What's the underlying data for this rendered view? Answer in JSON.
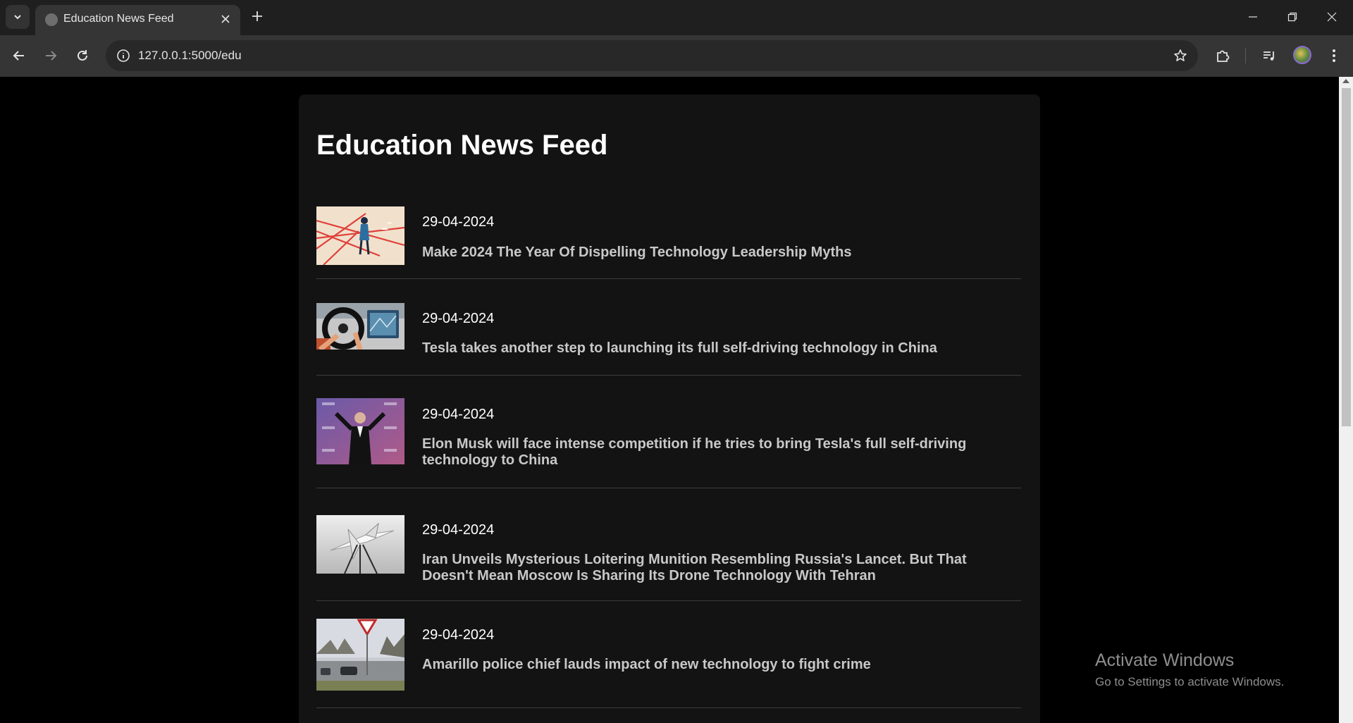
{
  "browser": {
    "tab_title": "Education News Feed",
    "url": "127.0.0.1:5000/edu"
  },
  "page": {
    "title": "Education News Feed"
  },
  "news": [
    {
      "date": "29-04-2024",
      "title": "Make 2024 The Year Of Dispelling Technology Leadership Myths"
    },
    {
      "date": "29-04-2024",
      "title": "Tesla takes another step to launching its full self-driving technology in China"
    },
    {
      "date": "29-04-2024",
      "title": "Elon Musk will face intense competition if he tries to bring Tesla's full self-driving technology to China"
    },
    {
      "date": "29-04-2024",
      "title": "Iran Unveils Mysterious Loitering Munition Resembling Russia's Lancet. But That Doesn't Mean Moscow Is Sharing Its Drone Technology With Tehran"
    },
    {
      "date": "29-04-2024",
      "title": "Amarillo police chief lauds impact of new technology to fight crime"
    }
  ],
  "watermark": {
    "title": "Activate Windows",
    "subtitle": "Go to Settings to activate Windows."
  }
}
